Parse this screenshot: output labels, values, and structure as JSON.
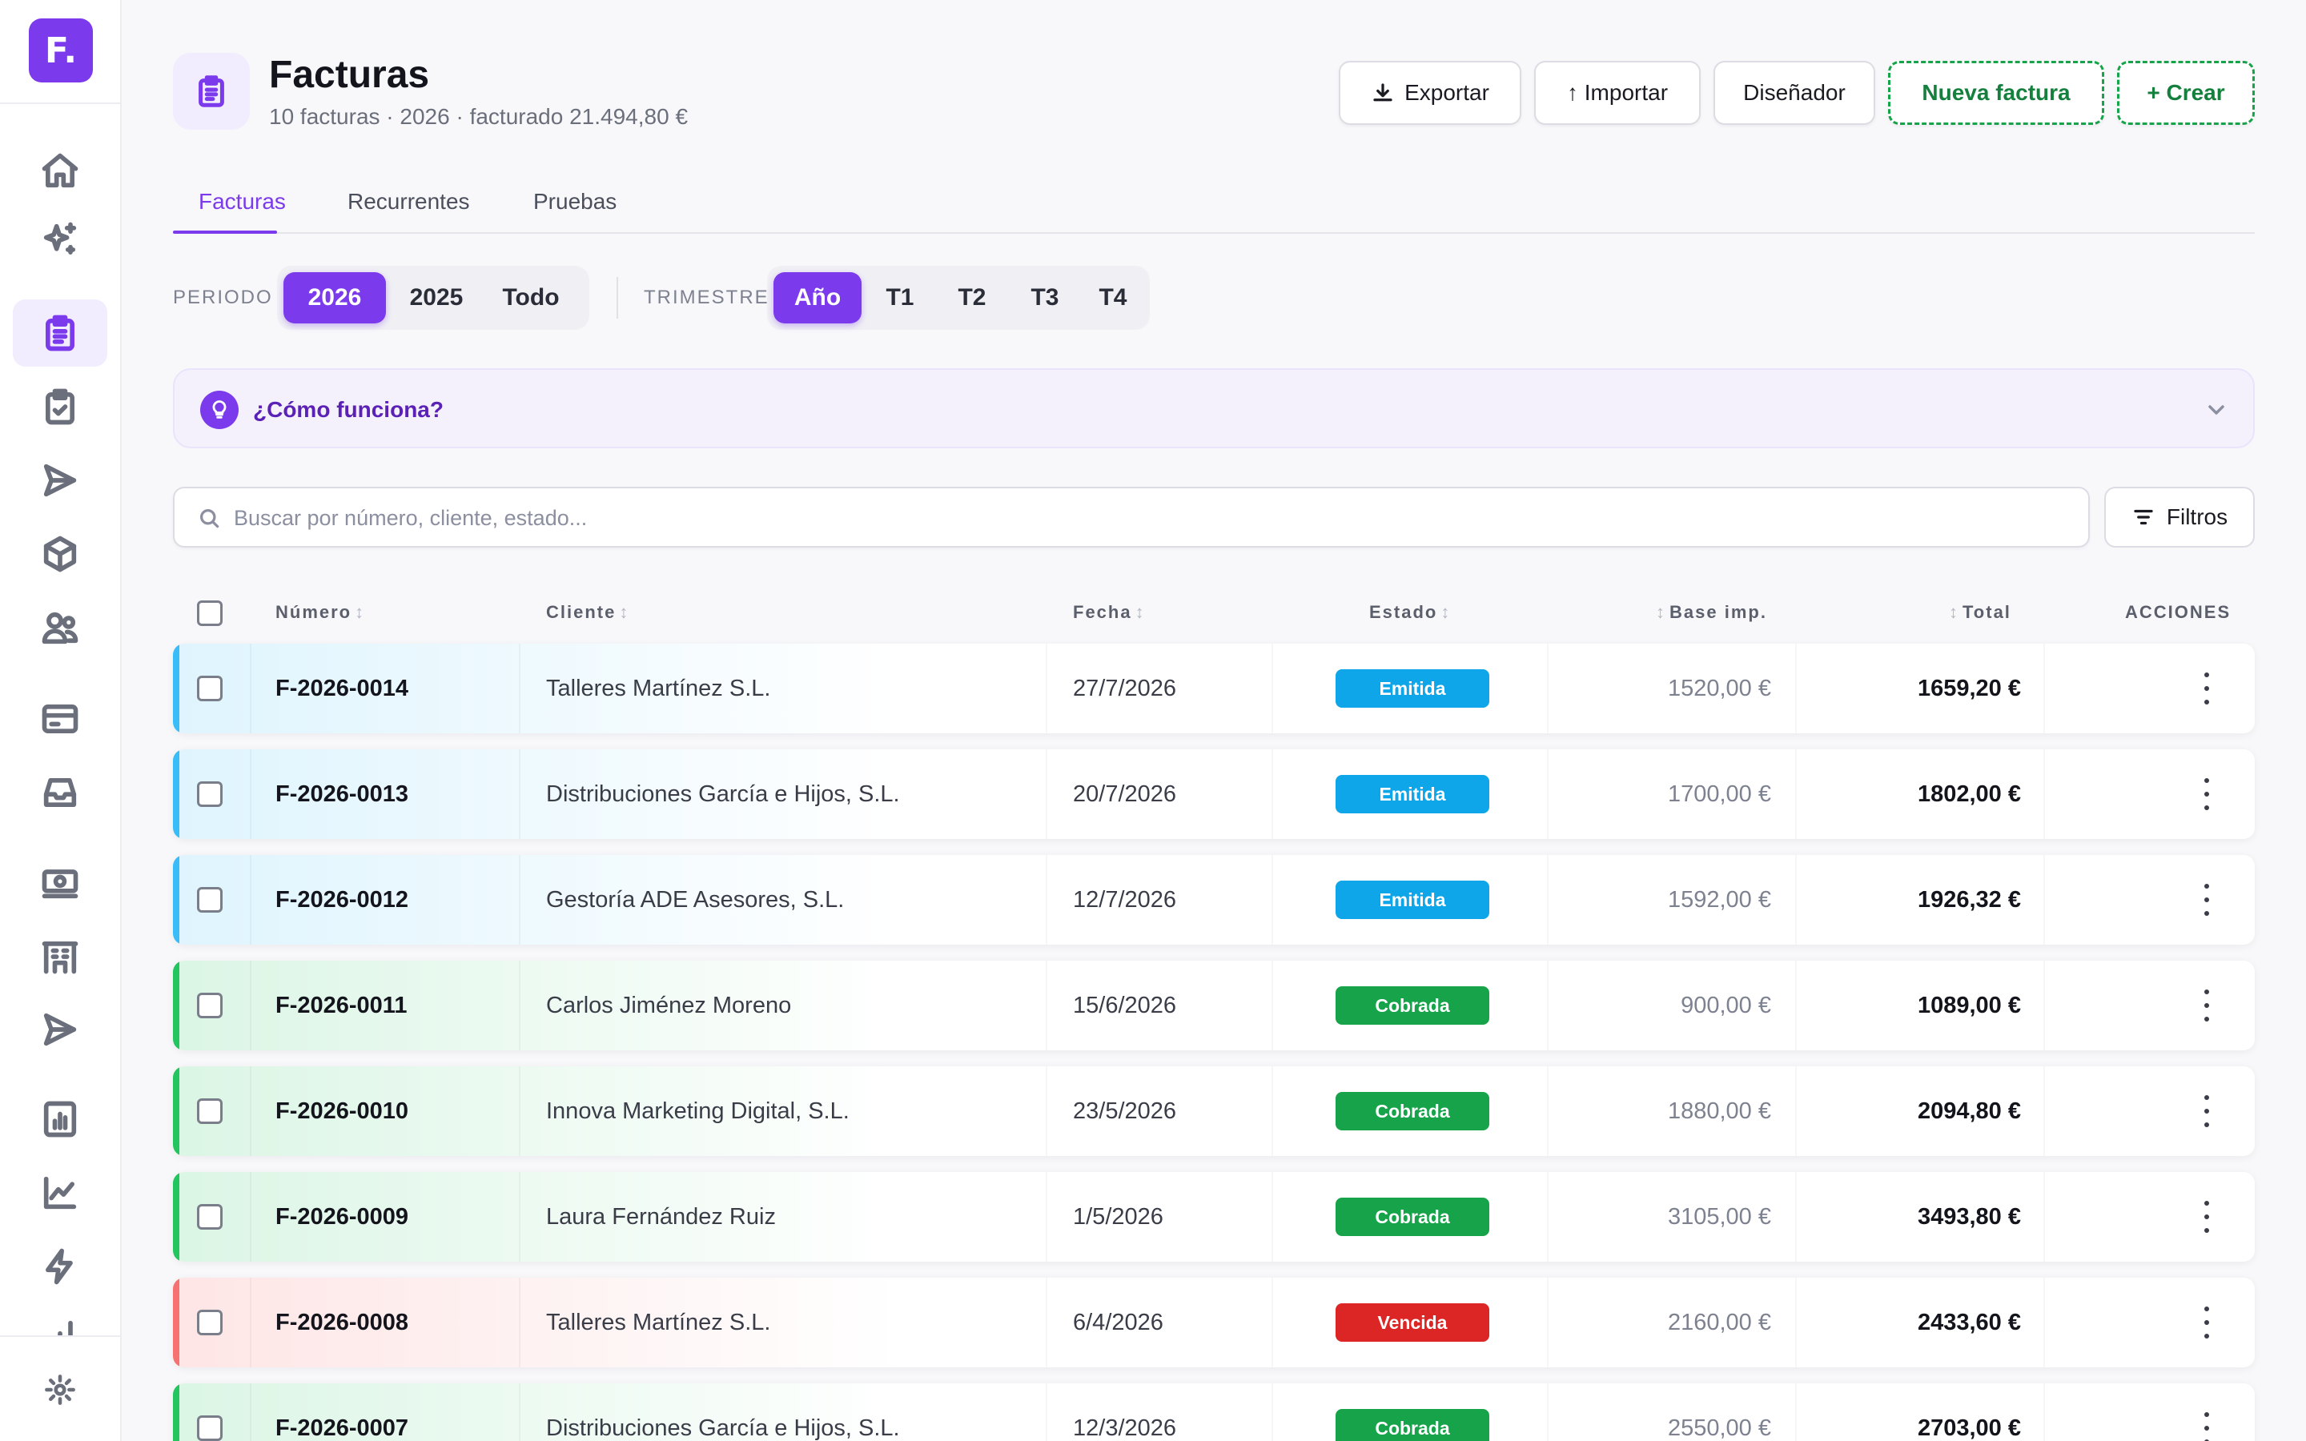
{
  "app": {
    "logo_text": "F.",
    "brand_color": "#7c3aed"
  },
  "sidebar": {
    "items": [
      {
        "icon": "home-icon",
        "active": false
      },
      {
        "icon": "sparkles-icon",
        "active": false
      },
      {
        "icon": "clipboard-list-icon",
        "active": true
      },
      {
        "icon": "clipboard-check-icon",
        "active": false
      },
      {
        "icon": "send-icon",
        "active": false
      },
      {
        "icon": "box-icon",
        "active": false
      },
      {
        "icon": "users-icon",
        "active": false
      },
      {
        "icon": "credit-card-icon",
        "active": false
      },
      {
        "icon": "inbox-icon",
        "active": false
      },
      {
        "icon": "banknote-icon",
        "active": false
      },
      {
        "icon": "building-icon",
        "active": false
      },
      {
        "icon": "send-icon",
        "active": false
      },
      {
        "icon": "report-icon",
        "active": false
      },
      {
        "icon": "line-chart-icon",
        "active": false
      },
      {
        "icon": "zap-icon",
        "active": false
      },
      {
        "icon": "bar-chart-icon",
        "active": false
      },
      {
        "icon": "settings-icon",
        "active": false
      }
    ]
  },
  "header": {
    "title": "Facturas",
    "subtitle": "10 facturas · 2026 · facturado 21.494,80 €",
    "buttons": {
      "export": "Exportar",
      "import": "↑ Importar",
      "designer": "Diseñador",
      "new_invoice": "Nueva factura",
      "create": "+ Crear"
    }
  },
  "tabs": [
    {
      "label": "Facturas",
      "active": true
    },
    {
      "label": "Recurrentes",
      "active": false
    },
    {
      "label": "Pruebas",
      "active": false
    }
  ],
  "period": {
    "label": "PERIODO",
    "options": [
      "2026",
      "2025",
      "Todo"
    ],
    "selected": "2026"
  },
  "quarter": {
    "label": "TRIMESTRE",
    "options": [
      "Año",
      "T1",
      "T2",
      "T3",
      "T4"
    ],
    "selected": "Año"
  },
  "how_it_works": {
    "label": "¿Cómo funciona?"
  },
  "search": {
    "placeholder": "Buscar por número, cliente, estado...",
    "value": ""
  },
  "filters_label": "Filtros",
  "table": {
    "headers": {
      "number": "Número",
      "client": "Cliente",
      "date": "Fecha",
      "status": "Estado",
      "base": "Base imp.",
      "total": "Total",
      "actions": "ACCIONES"
    },
    "rows": [
      {
        "number": "F-2026-0014",
        "client": "Talleres Martínez S.L.",
        "date": "27/7/2026",
        "status": "Emitida",
        "base": "1520,00 €",
        "total": "1659,20 €"
      },
      {
        "number": "F-2026-0013",
        "client": "Distribuciones García e Hijos, S.L.",
        "date": "20/7/2026",
        "status": "Emitida",
        "base": "1700,00 €",
        "total": "1802,00 €"
      },
      {
        "number": "F-2026-0012",
        "client": "Gestoría ADE Asesores, S.L.",
        "date": "12/7/2026",
        "status": "Emitida",
        "base": "1592,00 €",
        "total": "1926,32 €"
      },
      {
        "number": "F-2026-0011",
        "client": "Carlos Jiménez Moreno",
        "date": "15/6/2026",
        "status": "Cobrada",
        "base": "900,00 €",
        "total": "1089,00 €"
      },
      {
        "number": "F-2026-0010",
        "client": "Innova Marketing Digital, S.L.",
        "date": "23/5/2026",
        "status": "Cobrada",
        "base": "1880,00 €",
        "total": "2094,80 €"
      },
      {
        "number": "F-2026-0009",
        "client": "Laura Fernández Ruiz",
        "date": "1/5/2026",
        "status": "Cobrada",
        "base": "3105,00 €",
        "total": "3493,80 €"
      },
      {
        "number": "F-2026-0008",
        "client": "Talleres Martínez S.L.",
        "date": "6/4/2026",
        "status": "Vencida",
        "base": "2160,00 €",
        "total": "2433,60 €"
      },
      {
        "number": "F-2026-0007",
        "client": "Distribuciones García e Hijos, S.L.",
        "date": "12/3/2026",
        "status": "Cobrada",
        "base": "2550,00 €",
        "total": "2703,00 €"
      }
    ]
  },
  "status_colors": {
    "Emitida": "#0ea5e9",
    "Cobrada": "#16a34a",
    "Vencida": "#dc2626"
  }
}
